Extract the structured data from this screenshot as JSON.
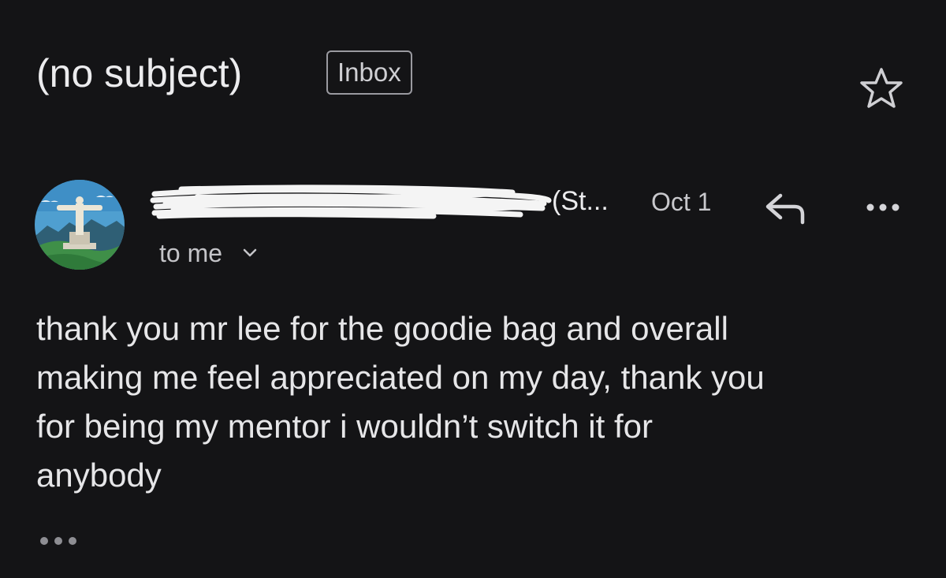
{
  "email": {
    "subject": "(no subject)",
    "label": "Inbox",
    "sender_visible": "(St...",
    "date": "Oct 1",
    "recipient": "to me",
    "body_lines": [
      "thank you mr lee for the goodie bag and overall",
      "making me feel appreciated on my day, thank you",
      "for being my mentor i wouldn’t switch it for",
      "anybody"
    ]
  },
  "icons": {
    "star": "star-outline-icon",
    "reply": "reply-arrow-icon",
    "more": "more-horizontal-icon",
    "expand": "chevron-down-icon",
    "trimmed": "show-trimmed-content-icon"
  },
  "colors": {
    "background": "#141416",
    "text_primary": "#ececee",
    "text_secondary": "#c4c4c8",
    "chip_border": "#9a9aa0"
  }
}
